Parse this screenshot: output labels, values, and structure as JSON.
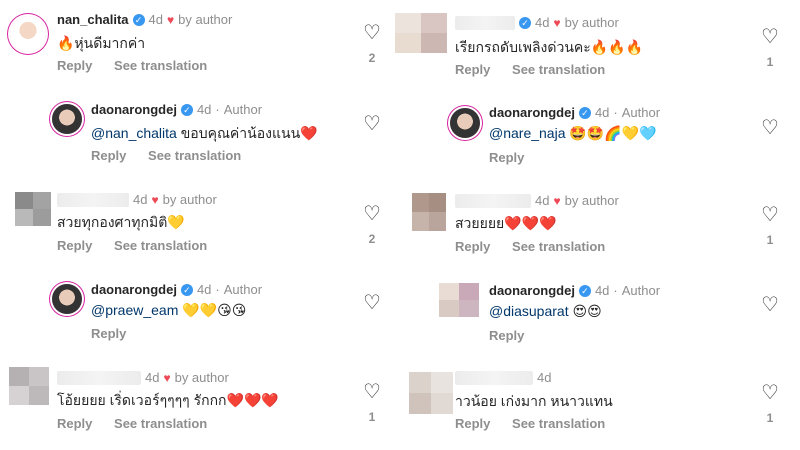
{
  "left": [
    {
      "user": "nan_chalita",
      "verified": true,
      "time": "4d",
      "liked_by": "by author",
      "text": "🔥หุ่นดีมากค่า",
      "reply": "Reply",
      "translate": "See translation",
      "likes": "2"
    },
    {
      "user": "daonarongdej",
      "verified": true,
      "time": "4d",
      "role": "Author",
      "mention": "@nan_chalita",
      "text": " ขอบคุณค่าน้องแนน❤️",
      "reply": "Reply",
      "translate": "See translation"
    },
    {
      "user": "",
      "time": "4d",
      "liked_by": "by author",
      "text": "สวยทุกองศาทุกมิติ💛",
      "reply": "Reply",
      "translate": "See translation",
      "likes": "2"
    },
    {
      "user": "daonarongdej",
      "verified": true,
      "time": "4d",
      "role": "Author",
      "mention": "@praew_eam",
      "text": " 💛💛😘😘",
      "reply": "Reply"
    },
    {
      "user": "",
      "time": "4d",
      "liked_by": "by author",
      "text": "โอ้ยยยย เริ่ดเวอร์ๆๆๆๆ รักกก❤️❤️❤️",
      "reply": "Reply",
      "translate": "See translation",
      "likes": "1"
    }
  ],
  "right": [
    {
      "user": "",
      "time": "4d",
      "liked_by": "by author",
      "text": "เรียกรถดับเพลิงด่วนคะ🔥🔥🔥",
      "reply": "Reply",
      "translate": "See translation",
      "likes": "1"
    },
    {
      "user": "daonarongdej",
      "verified": true,
      "time": "4d",
      "role": "Author",
      "mention": "@nare_naja",
      "text": " 🤩🤩🌈💛🩵",
      "reply": "Reply"
    },
    {
      "user": "",
      "time": "4d",
      "liked_by": "by author",
      "text": "สวยยยย❤️❤️❤️",
      "reply": "Reply",
      "translate": "See translation",
      "likes": "1"
    },
    {
      "user": "daonarongdej",
      "verified": true,
      "time": "4d",
      "role": "Author",
      "mention": "@diasuparat",
      "text": " 😍😍",
      "reply": "Reply"
    },
    {
      "user": "",
      "time": "4d",
      "text": "าวน้อย เก่งมาก หนาวแทน",
      "reply": "Reply",
      "translate": "See translation",
      "likes": "1"
    }
  ],
  "icons": {
    "verified": "verified-badge-icon",
    "heart": "heart-outline-icon",
    "liked": "heart-filled-icon"
  },
  "colors": {
    "link": "#00376b",
    "meta": "#8e8e8e",
    "heart": "#ed4956",
    "verified": "#3897f0"
  }
}
